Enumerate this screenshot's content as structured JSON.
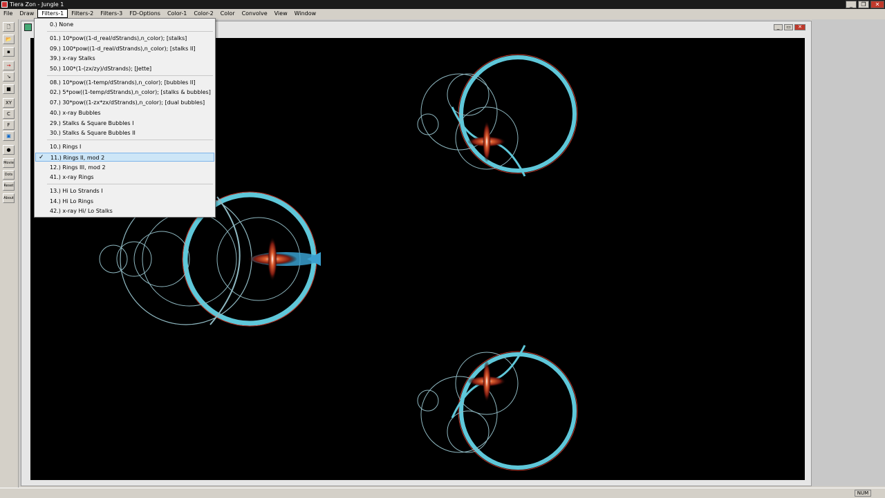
{
  "window": {
    "title": "Tiera Zon - Jungle 1"
  },
  "menubar": [
    "File",
    "Draw",
    "Filters-1",
    "Filters-2",
    "Filters-3",
    "FD-Options",
    "Color-1",
    "Color-2",
    "Color",
    "Convolve",
    "View",
    "Window"
  ],
  "toolbar": {
    "labels": [
      "XY",
      "C",
      "F"
    ],
    "words": [
      "Movie",
      "Dots",
      "Reset",
      "About"
    ]
  },
  "dropdown": {
    "items": [
      "0.) None",
      "01.) 10*pow((1-d_real/dStrands),n_color); [stalks]",
      "09.) 100*pow((1-d_real/dStrands),n_color); [stalks II]",
      "39.) x-ray Stalks",
      "50.) 100*(1-(zx/zy)/dStrands); [Jette]",
      "08.) 10*pow((1-temp/dStrands),n_color); [bubbles II]",
      "02.) 5*pow((1-temp/dStrands),n_color); [stalks & bubbles]",
      "07.) 30*pow((1-zx*zx/dStrands),n_color); [dual bubbles]",
      "40.) x-ray Bubbles",
      "29.) Stalks & Square Bubbles I",
      "30.) Stalks & Square Bubbles II",
      "10.) Rings I",
      "11.) Rings II, mod 2",
      "12.) Rings III, mod 2",
      "41.) x-ray Rings",
      "13.) Hi Lo Strands I",
      "14.) Hi Lo Rings",
      "42.) x-ray Hi/ Lo Stalks"
    ],
    "selected_index": 12,
    "check_mark": "✓"
  },
  "statusbar": {
    "num": "NUM"
  },
  "colors": {
    "ring_cyan": "#5fc7d9",
    "ring_red": "#c0392b",
    "canvas_bg": "#000000"
  }
}
